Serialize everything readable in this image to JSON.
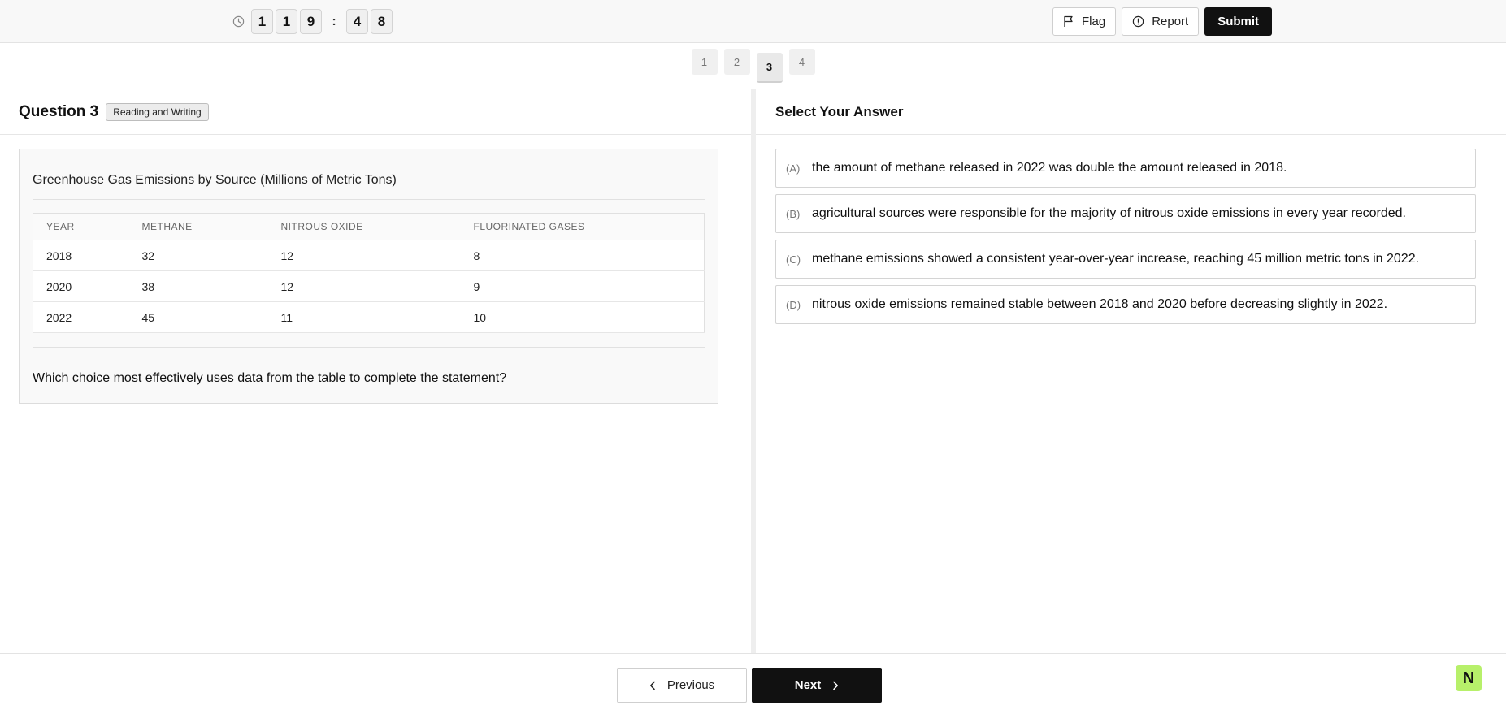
{
  "timer": {
    "hours": [
      "1",
      "1",
      "9"
    ],
    "separator": ":",
    "minutes": [
      "4",
      "8"
    ]
  },
  "toolbar": {
    "flag_label": "Flag",
    "report_label": "Report",
    "submit_label": "Submit"
  },
  "pagination": {
    "pages": [
      "1",
      "2",
      "3",
      "4"
    ],
    "current": "3"
  },
  "question": {
    "title": "Question 3",
    "tag": "Reading and Writing",
    "table_title": "Greenhouse Gas Emissions by Source (Millions of Metric Tons)",
    "columns": [
      "YEAR",
      "METHANE",
      "NITROUS OXIDE",
      "FLUORINATED GASES"
    ],
    "rows": [
      [
        "2018",
        "32",
        "12",
        "8"
      ],
      [
        "2020",
        "38",
        "12",
        "9"
      ],
      [
        "2022",
        "45",
        "11",
        "10"
      ]
    ],
    "prompt": "Which choice most effectively uses data from the table to complete the statement?"
  },
  "answers": {
    "title": "Select Your Answer",
    "choices": [
      {
        "letter": "(A)",
        "text": "the amount of methane released in 2022 was double the amount released in 2018."
      },
      {
        "letter": "(B)",
        "text": "agricultural sources were responsible for the majority of nitrous oxide emissions in every year recorded."
      },
      {
        "letter": "(C)",
        "text": "methane emissions showed a consistent year-over-year increase, reaching 45 million metric tons in 2022."
      },
      {
        "letter": "(D)",
        "text": "nitrous oxide emissions remained stable between 2018 and 2020 before decreasing slightly in 2022."
      }
    ]
  },
  "navigation": {
    "previous_label": "Previous",
    "next_label": "Next"
  },
  "brand": {
    "badge": "N",
    "accent": "#b7f06a"
  }
}
